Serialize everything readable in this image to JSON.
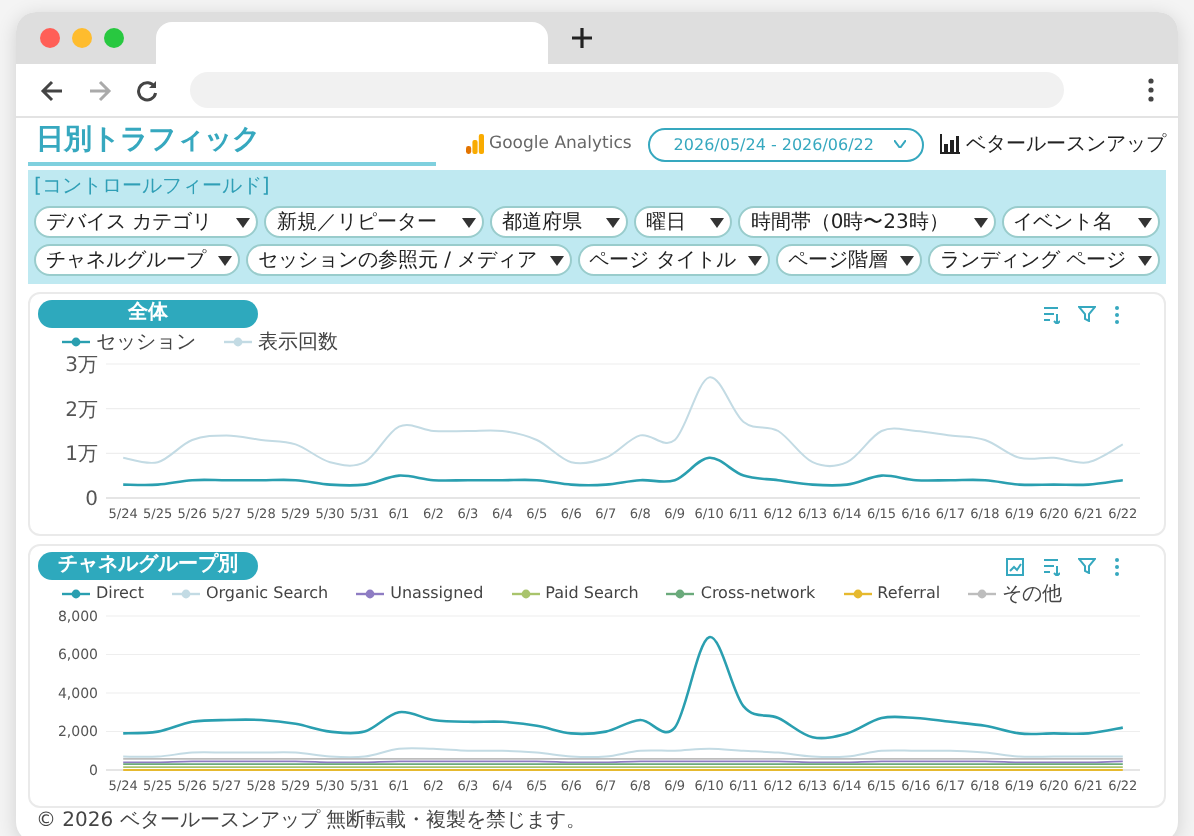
{
  "header": {
    "title": "日別トラフィック",
    "ga_label": "Google Analytics",
    "date_range": "2026/05/24 - 2026/06/22",
    "brand": "ベタールースンアップ"
  },
  "controls": {
    "label": "[コントロールフィールド]",
    "dropdowns": [
      "デバイス カテゴリ",
      "新規／リピーター",
      "都道府県",
      "曜日",
      "時間帯（0時〜23時）",
      "イベント名",
      "チャネルグループ",
      "セッションの参照元 / メディア",
      "ページ タイトル",
      "ページ階層",
      "ランディング ページ"
    ]
  },
  "panels": [
    {
      "title": "全体",
      "chart_data": {
        "type": "line",
        "grid": true,
        "categories": [
          "5/24",
          "5/25",
          "5/26",
          "5/27",
          "5/28",
          "5/29",
          "5/30",
          "5/31",
          "6/1",
          "6/2",
          "6/3",
          "6/4",
          "6/5",
          "6/6",
          "6/7",
          "6/8",
          "6/9",
          "6/10",
          "6/11",
          "6/12",
          "6/13",
          "6/14",
          "6/15",
          "6/16",
          "6/17",
          "6/18",
          "6/19",
          "6/20",
          "6/21",
          "6/22"
        ],
        "ylim": [
          0,
          3
        ],
        "yticks": [
          {
            "value": 0,
            "label": "0"
          },
          {
            "value": 1,
            "label": "1万"
          },
          {
            "value": 2,
            "label": "2万"
          },
          {
            "value": 3,
            "label": "3万"
          }
        ],
        "series": [
          {
            "name": "セッション",
            "color": "#2a9fb0",
            "values": [
              0.3,
              0.3,
              0.4,
              0.4,
              0.4,
              0.4,
              0.3,
              0.3,
              0.5,
              0.4,
              0.4,
              0.4,
              0.4,
              0.3,
              0.3,
              0.4,
              0.4,
              0.9,
              0.5,
              0.4,
              0.3,
              0.3,
              0.5,
              0.4,
              0.4,
              0.4,
              0.3,
              0.3,
              0.3,
              0.4
            ]
          },
          {
            "name": "表示回数",
            "color": "#c3dbe4",
            "values": [
              0.9,
              0.8,
              1.3,
              1.4,
              1.3,
              1.2,
              0.8,
              0.8,
              1.6,
              1.5,
              1.5,
              1.5,
              1.3,
              0.8,
              0.9,
              1.4,
              1.3,
              2.7,
              1.7,
              1.5,
              0.8,
              0.8,
              1.5,
              1.5,
              1.4,
              1.3,
              0.9,
              0.9,
              0.8,
              1.2
            ]
          }
        ]
      }
    },
    {
      "title": "チャネルグループ別",
      "chart_data": {
        "type": "line",
        "grid": true,
        "categories": [
          "5/24",
          "5/25",
          "5/26",
          "5/27",
          "5/28",
          "5/29",
          "5/30",
          "5/31",
          "6/1",
          "6/2",
          "6/3",
          "6/4",
          "6/5",
          "6/6",
          "6/7",
          "6/8",
          "6/9",
          "6/10",
          "6/11",
          "6/12",
          "6/13",
          "6/14",
          "6/15",
          "6/16",
          "6/17",
          "6/18",
          "6/19",
          "6/20",
          "6/21",
          "6/22"
        ],
        "ylim": [
          0,
          8000
        ],
        "yticks": [
          {
            "value": 0,
            "label": "0"
          },
          {
            "value": 2000,
            "label": "2,000"
          },
          {
            "value": 4000,
            "label": "4,000"
          },
          {
            "value": 6000,
            "label": "6,000"
          },
          {
            "value": 8000,
            "label": "8,000"
          }
        ],
        "series": [
          {
            "name": "Direct",
            "color": "#2a9fb0",
            "values": [
              1900,
              2000,
              2500,
              2600,
              2600,
              2400,
              2000,
              2000,
              3000,
              2600,
              2500,
              2500,
              2300,
              1900,
              2000,
              2600,
              2200,
              6900,
              3300,
              2700,
              1700,
              1900,
              2700,
              2700,
              2500,
              2300,
              1900,
              1900,
              1900,
              2200
            ]
          },
          {
            "name": "Organic Search",
            "color": "#c3dbe4",
            "values": [
              700,
              700,
              900,
              900,
              900,
              900,
              700,
              700,
              1100,
              1100,
              1000,
              1000,
              900,
              700,
              700,
              1000,
              1000,
              1100,
              1000,
              900,
              700,
              700,
              1000,
              1000,
              1000,
              900,
              700,
              700,
              700,
              700
            ]
          },
          {
            "name": "Unassigned",
            "color": "#8e7cc3",
            "values": [
              400,
              400,
              450,
              450,
              450,
              450,
              400,
              400,
              450,
              450,
              450,
              450,
              450,
              400,
              400,
              450,
              450,
              450,
              450,
              450,
              400,
              400,
              450,
              450,
              450,
              450,
              400,
              400,
              400,
              450
            ]
          },
          {
            "name": "Paid Search",
            "color": "#a9c46c",
            "values": [
              150,
              150,
              150,
              150,
              150,
              150,
              150,
              150,
              150,
              150,
              150,
              150,
              150,
              150,
              150,
              150,
              150,
              150,
              150,
              150,
              150,
              150,
              150,
              150,
              150,
              150,
              150,
              150,
              150,
              150
            ]
          },
          {
            "name": "Cross-network",
            "color": "#6aaa7b",
            "values": [
              300,
              300,
              300,
              300,
              300,
              300,
              300,
              300,
              300,
              300,
              300,
              300,
              300,
              300,
              300,
              300,
              300,
              300,
              300,
              300,
              300,
              300,
              300,
              300,
              300,
              300,
              300,
              300,
              300,
              300
            ]
          },
          {
            "name": "Referral",
            "color": "#e6b92e",
            "values": [
              0,
              0,
              0,
              0,
              0,
              0,
              0,
              0,
              0,
              0,
              0,
              0,
              0,
              0,
              0,
              0,
              0,
              0,
              0,
              0,
              0,
              0,
              0,
              0,
              0,
              0,
              0,
              0,
              0,
              0
            ]
          },
          {
            "name": "その他",
            "color": "#bdbdbd",
            "values": [
              580,
              580,
              580,
              580,
              580,
              580,
              580,
              580,
              580,
              580,
              580,
              580,
              580,
              580,
              580,
              580,
              580,
              580,
              580,
              580,
              580,
              580,
              580,
              580,
              580,
              580,
              580,
              580,
              580,
              580
            ]
          }
        ]
      }
    }
  ],
  "footer": "© 2026 ベタールースンアップ 無断転載・複製を禁じます。"
}
